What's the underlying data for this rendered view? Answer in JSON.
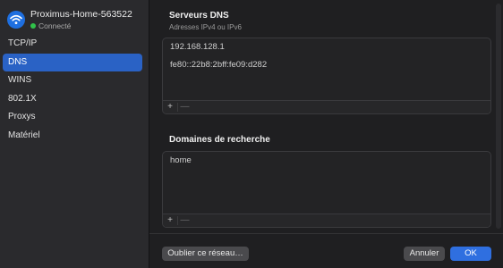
{
  "network": {
    "name": "Proximus-Home-563522",
    "status": "Connecté",
    "icon": "wifi-icon",
    "status_color": "#30c24a"
  },
  "sidebar": {
    "items": [
      {
        "label": "TCP/IP"
      },
      {
        "label": "DNS",
        "active": true
      },
      {
        "label": "WINS"
      },
      {
        "label": "802.1X"
      },
      {
        "label": "Proxys"
      },
      {
        "label": "Matériel"
      }
    ]
  },
  "dns": {
    "title": "Serveurs DNS",
    "subtitle": "Adresses IPv4 ou IPv6",
    "servers": [
      "192.168.128.1",
      "fe80::22b8:2bff:fe09:d282"
    ]
  },
  "search": {
    "title": "Domaines de recherche",
    "domains": [
      "home"
    ]
  },
  "controls": {
    "add": "+",
    "remove": "—"
  },
  "buttons": {
    "forget": "Oublier ce réseau…",
    "cancel": "Annuler",
    "ok": "OK"
  },
  "colors": {
    "accent": "#2f6fe0",
    "selection": "#2a62c5"
  }
}
